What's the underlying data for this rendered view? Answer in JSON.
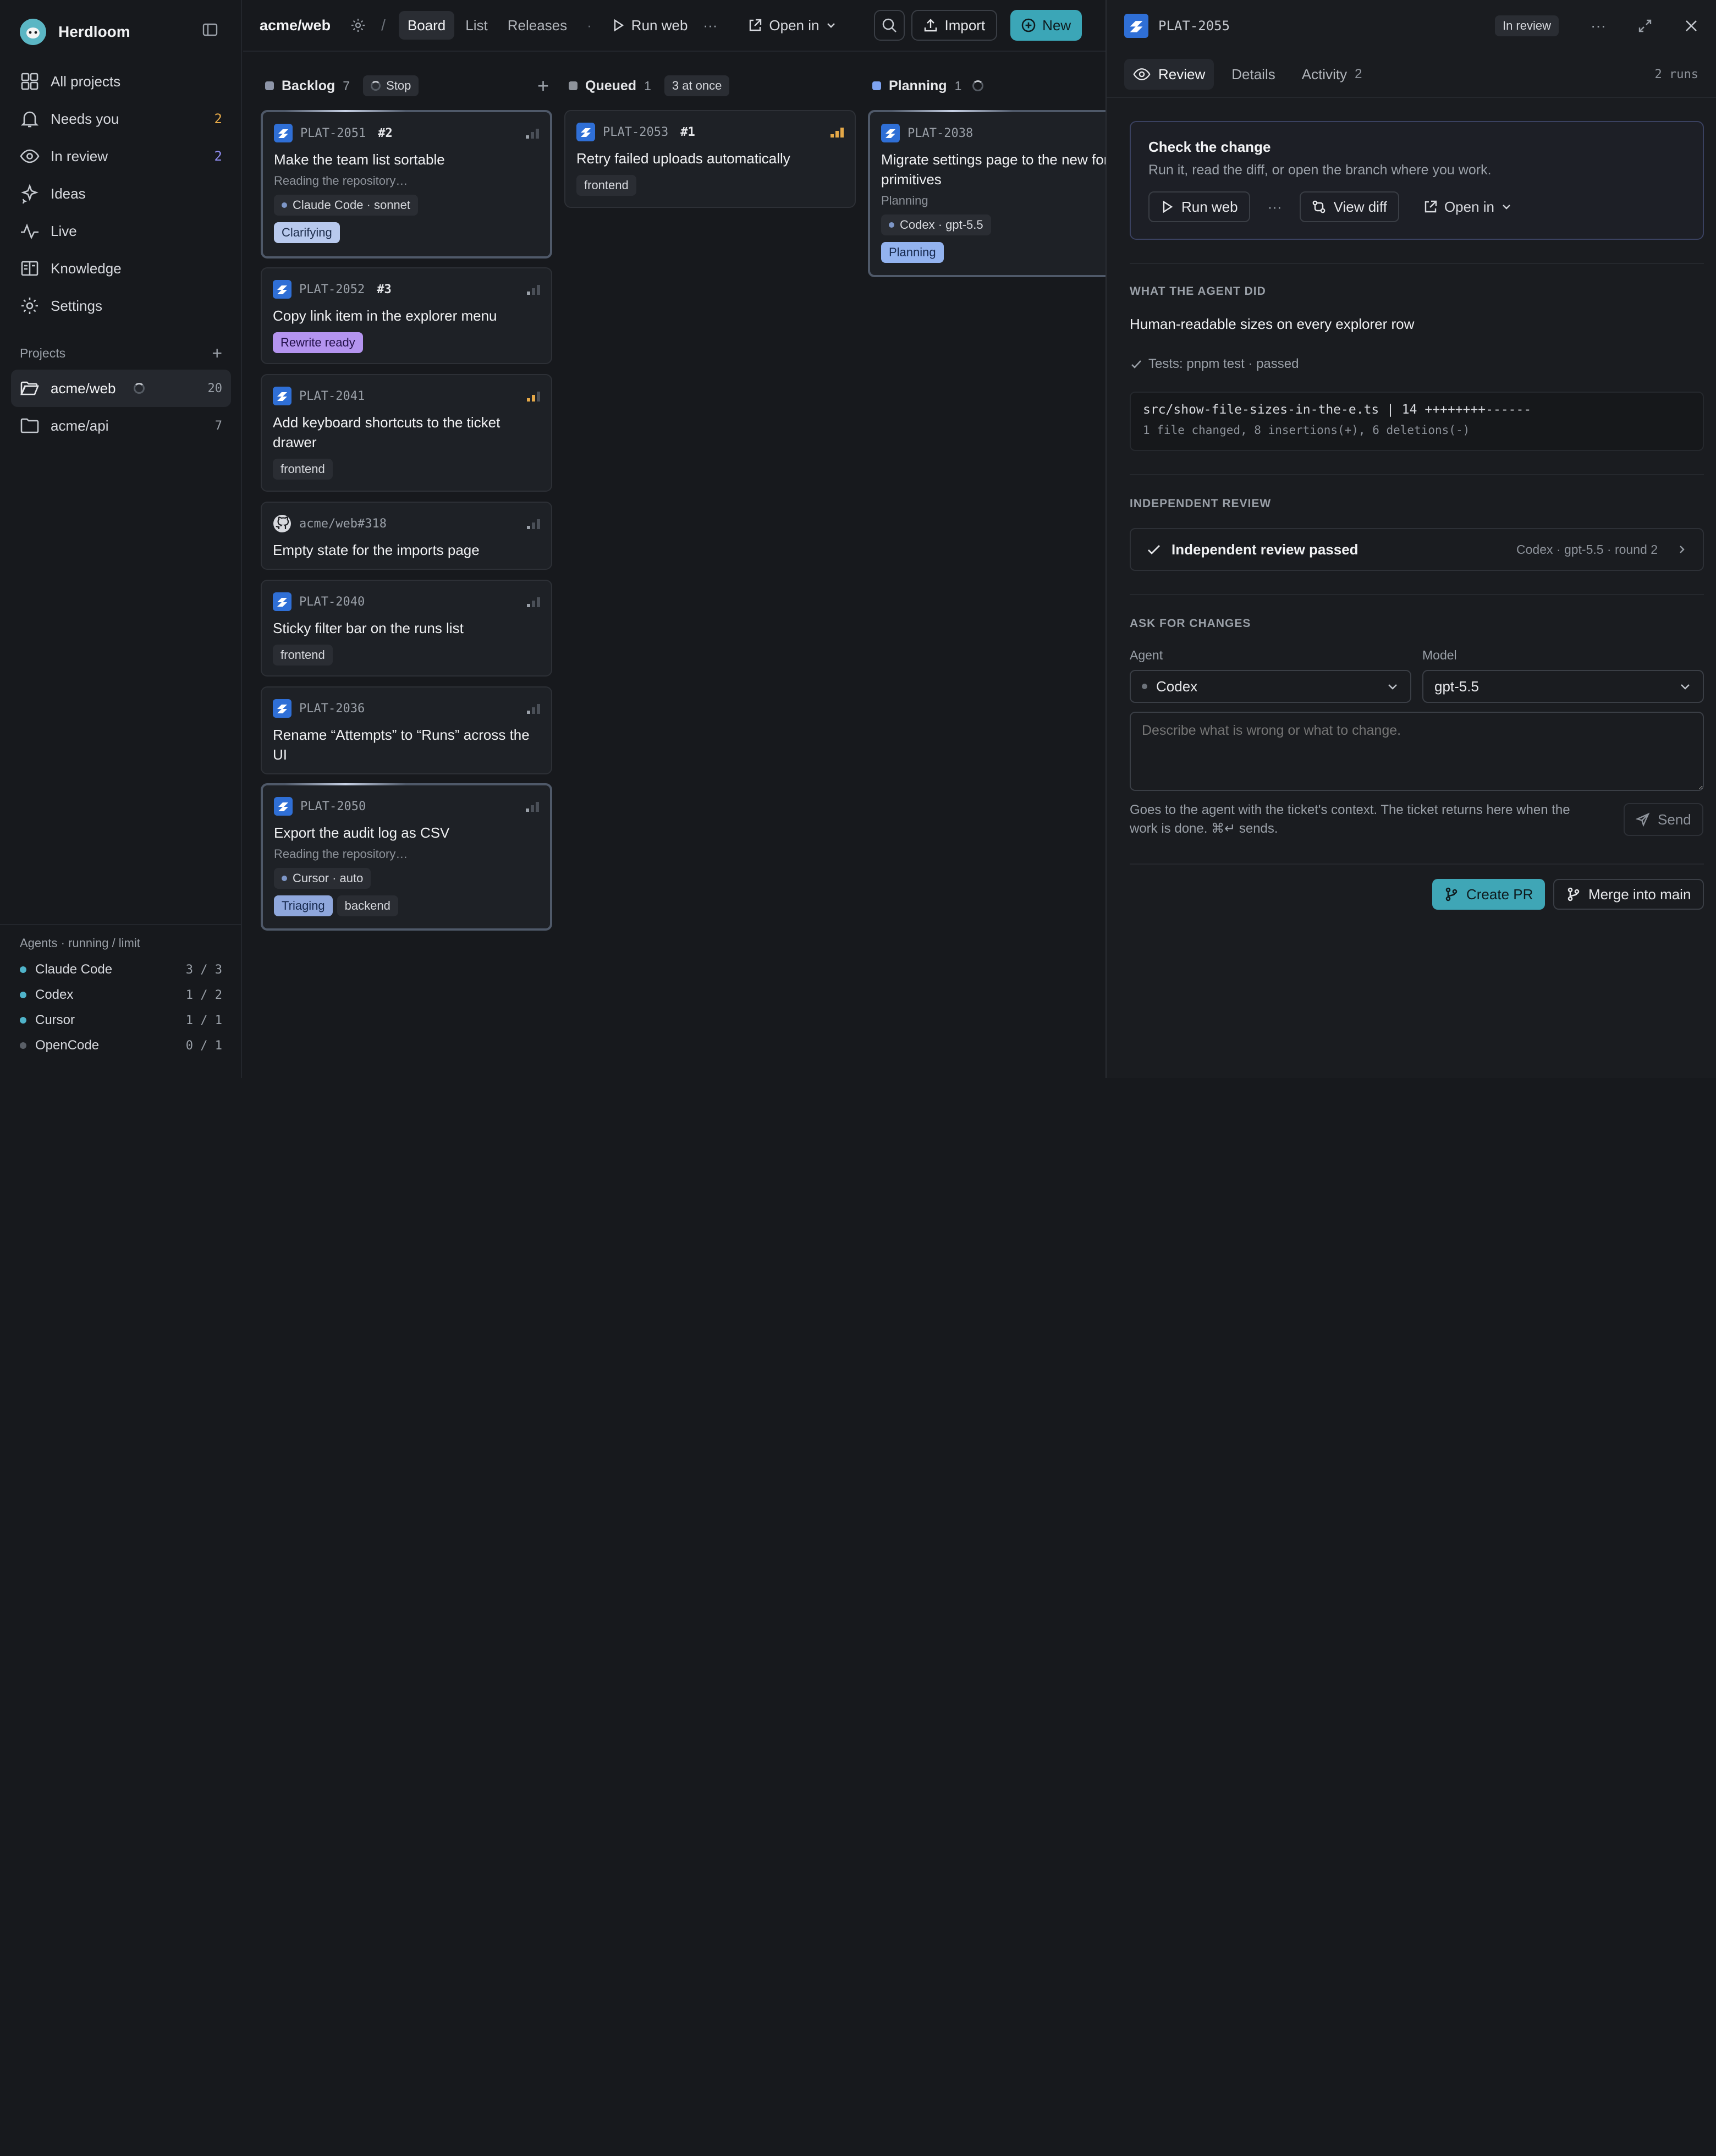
{
  "app": {
    "name": "Herdloom"
  },
  "nav": [
    {
      "label": "All projects",
      "icon": "grid-icon"
    },
    {
      "label": "Needs you",
      "icon": "bell-icon",
      "count": "2",
      "count_color": "#e4a848"
    },
    {
      "label": "In review",
      "icon": "eye-icon",
      "count": "2",
      "count_color": "#8f8cf0"
    },
    {
      "label": "Ideas",
      "icon": "sparkle-icon"
    },
    {
      "label": "Live",
      "icon": "activity-icon"
    },
    {
      "label": "Knowledge",
      "icon": "book-icon"
    },
    {
      "label": "Settings",
      "icon": "gear-icon"
    }
  ],
  "projects": {
    "heading": "Projects",
    "items": [
      {
        "label": "acme/web",
        "count": "20"
      },
      {
        "label": "acme/api",
        "count": "7"
      }
    ]
  },
  "agents": {
    "heading": "Agents · running / limit",
    "items": [
      {
        "name": "Claude Code",
        "usage": "3 / 3",
        "color": "#4fb3c9"
      },
      {
        "name": "Codex",
        "usage": "1 / 2",
        "color": "#4fb3c9"
      },
      {
        "name": "Cursor",
        "usage": "1 / 1",
        "color": "#4fb3c9"
      },
      {
        "name": "OpenCode",
        "usage": "0 / 1",
        "color": "#5a5f67"
      }
    ]
  },
  "topbar": {
    "repo": "acme/web",
    "tabs": [
      "Board",
      "List",
      "Releases"
    ],
    "run_label": "Run web",
    "ellipsis": "···",
    "open_in": "Open in",
    "import_label": "Import",
    "new_label": "New"
  },
  "columns": [
    {
      "name": "Backlog",
      "count": "7",
      "action": "Stop",
      "color": "#8d95a8"
    },
    {
      "name": "Queued",
      "count": "1",
      "note": "3 at once",
      "color": "#8e939b"
    },
    {
      "name": "Planning",
      "count": "1",
      "color": "#7ea3f0"
    }
  ],
  "cards": [
    {
      "id": "PLAT-2051",
      "badge": "#2",
      "title": "Make the team list sortable",
      "sub": "Reading the repository…",
      "agent": "Claude Code · sonnet",
      "tag": "Clarifying"
    },
    {
      "id": "PLAT-2052",
      "badge": "#3",
      "title": "Copy link item in the explorer menu",
      "tag": "Rewrite ready"
    },
    {
      "id": "PLAT-2041",
      "title": "Add keyboard shortcuts to the ticket drawer",
      "tag": "frontend"
    },
    {
      "id": "acme/web#318",
      "title": "Empty state for the imports page"
    },
    {
      "id": "PLAT-2040",
      "title": "Sticky filter bar on the runs list",
      "tag": "frontend"
    },
    {
      "id": "PLAT-2036",
      "title": "Rename “Attempts” to “Runs” across the UI"
    },
    {
      "id": "PLAT-2050",
      "title": "Export the audit log as CSV",
      "sub": "Reading the repository…",
      "agent": "Cursor · auto",
      "tag": "Triaging",
      "tag2": "backend"
    },
    {
      "id": "PLAT-2053",
      "badge": "#1",
      "title": "Retry failed uploads automatically",
      "tag": "frontend"
    },
    {
      "id": "PLAT-2038",
      "title": "Migrate settings page to the new form primitives",
      "sub": "Planning",
      "agent": "Codex · gpt-5.5",
      "tag": "Planning"
    }
  ],
  "drawer": {
    "id": "PLAT-2055",
    "status": "In review",
    "tabs": [
      {
        "label": "Review"
      },
      {
        "label": "Details"
      },
      {
        "label": "Activity",
        "count": "2"
      }
    ],
    "runs": "2 runs",
    "check": {
      "title": "Check the change",
      "subtitle": "Run it, read the diff, or open the branch where you work.",
      "run_label": "Run web",
      "ellipsis": "···",
      "diff_label": "View diff",
      "open_label": "Open in"
    },
    "agent_did": {
      "heading": "WHAT THE AGENT DID",
      "summary": "Human-readable sizes on every explorer row",
      "tests": "Tests: pnpm test · passed",
      "diff_line": "src/show-file-sizes-in-the-e.ts | 14 ++++++++------",
      "diff_stat": "1 file changed, 8 insertions(+), 6 deletions(-)"
    },
    "review": {
      "heading": "INDEPENDENT REVIEW",
      "result": "Independent review passed",
      "meta": "Codex · gpt-5.5 · round 2"
    },
    "changes": {
      "heading": "ASK FOR CHANGES",
      "agent_label": "Agent",
      "agent_value": "Codex",
      "model_label": "Model",
      "model_value": "gpt-5.5",
      "placeholder": "Describe what is wrong or what to change.",
      "hint": "Goes to the agent with the ticket's context. The ticket returns here when the work is done. ⌘↵ sends.",
      "send_label": "Send"
    },
    "create_pr": "Create PR",
    "merge": "Merge into main"
  }
}
